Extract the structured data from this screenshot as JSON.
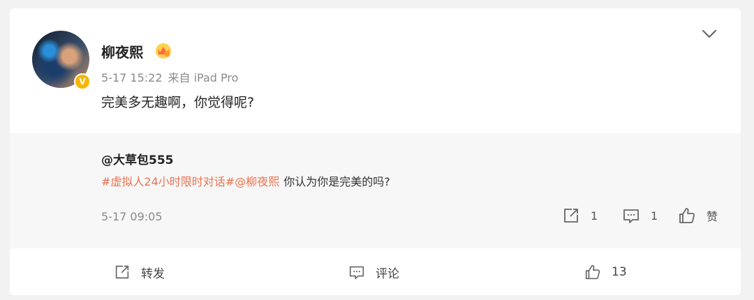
{
  "post": {
    "username": "柳夜熙",
    "timestamp": "5-17 15:22",
    "source": "来自 iPad Pro",
    "text": "完美多无趣啊，你觉得呢?",
    "verified_mark": "V",
    "avatar_icon": "avatar-portrait",
    "badge_icon": "crown-icon"
  },
  "repost": {
    "author": "@大草包555",
    "topic": "#虚拟人24小时限时对话#",
    "mention": "@柳夜熙",
    "text": "你认为你是完美的吗?",
    "timestamp": "5-17 09:05",
    "repost_count": "1",
    "comment_count": "1",
    "like_label": "赞"
  },
  "footer": {
    "repost_label": "转发",
    "comment_label": "评论",
    "like_count": "13"
  },
  "colors": {
    "link": "#eb7350",
    "background": "#f2f2f2",
    "card": "#ffffff",
    "repost_bg": "#f7f7f7"
  }
}
